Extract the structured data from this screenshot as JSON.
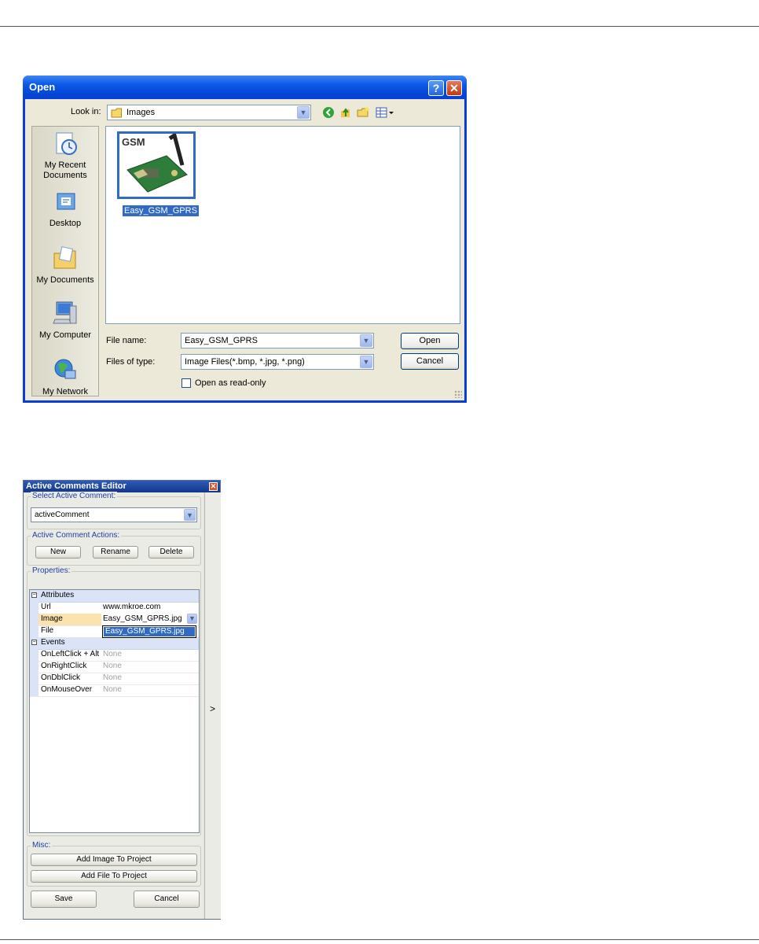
{
  "open_dialog": {
    "title": "Open",
    "help_glyph": "?",
    "close_glyph": "✕",
    "look_in_label": "Look in:",
    "look_in_value": "Images",
    "places": [
      {
        "label": "My Recent Documents",
        "icon": "recent-documents-icon"
      },
      {
        "label": "Desktop",
        "icon": "desktop-icon"
      },
      {
        "label": "My Documents",
        "icon": "my-documents-icon"
      },
      {
        "label": "My Computer",
        "icon": "my-computer-icon"
      },
      {
        "label": "My Network",
        "icon": "my-network-icon"
      }
    ],
    "files": [
      {
        "name": "Easy_GSM_GPRS",
        "thumb_logo": "GSM"
      }
    ],
    "file_name_label": "File name:",
    "file_name_value": "Easy_GSM_GPRS",
    "files_of_type_label": "Files of type:",
    "files_of_type_value": "Image Files(*.bmp, *.jpg, *.png)",
    "open_label": "Open",
    "cancel_label": "Cancel",
    "read_only_label": "Open as read-only"
  },
  "ace": {
    "title": "Active Comments Editor",
    "close_glyph": "✕",
    "select_group_label": "Select Active Comment:",
    "select_value": "activeComment",
    "actions_group_label": "Active Comment Actions:",
    "new_label": "New",
    "rename_label": "Rename",
    "delete_label": "Delete",
    "properties_group_label": "Properties:",
    "attributes_label": "Attributes",
    "url_name": "Url",
    "url_value": "www.mkroe.com",
    "image_name": "Image",
    "image_value": "Easy_GSM_GPRS.jpg",
    "image_dropdown_option": "Easy_GSM_GPRS.jpg",
    "file_name": "File",
    "events_label": "Events",
    "events": [
      {
        "name": "OnLeftClick + Alt",
        "value": "None"
      },
      {
        "name": "OnRightClick",
        "value": "None"
      },
      {
        "name": "OnDblClick",
        "value": "None"
      },
      {
        "name": "OnMouseOver",
        "value": "None"
      }
    ],
    "misc_group_label": "Misc:",
    "add_image_label": "Add Image To Project",
    "add_file_label": "Add File  To Project",
    "save_label": "Save",
    "cancel_label": "Cancel",
    "side_arrow": ">",
    "collapse_glyph": "−"
  }
}
